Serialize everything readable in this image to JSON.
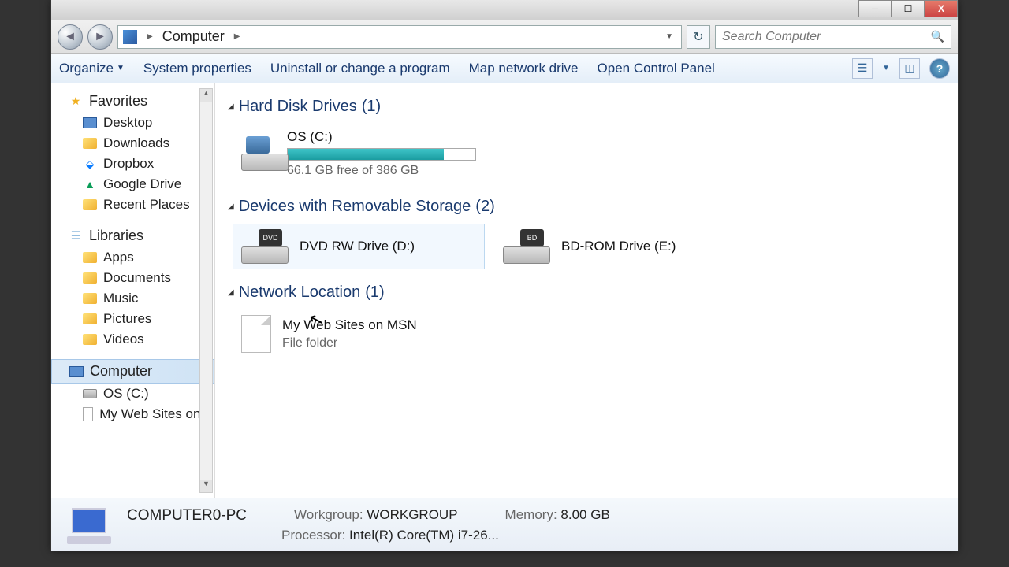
{
  "window": {
    "breadcrumb_root": "Computer",
    "search_placeholder": "Search Computer"
  },
  "toolbar": {
    "organize": "Organize",
    "system_properties": "System properties",
    "uninstall": "Uninstall or change a program",
    "map_drive": "Map network drive",
    "control_panel": "Open Control Panel"
  },
  "sidebar": {
    "favorites_label": "Favorites",
    "favorites": [
      {
        "label": "Desktop"
      },
      {
        "label": "Downloads"
      },
      {
        "label": "Dropbox"
      },
      {
        "label": "Google Drive"
      },
      {
        "label": "Recent Places"
      }
    ],
    "libraries_label": "Libraries",
    "libraries": [
      {
        "label": "Apps"
      },
      {
        "label": "Documents"
      },
      {
        "label": "Music"
      },
      {
        "label": "Pictures"
      },
      {
        "label": "Videos"
      }
    ],
    "computer_label": "Computer",
    "computer": [
      {
        "label": "OS (C:)"
      },
      {
        "label": "My Web Sites on M"
      }
    ]
  },
  "sections": {
    "hdd": {
      "title": "Hard Disk Drives",
      "count": "(1)"
    },
    "removable": {
      "title": "Devices with Removable Storage",
      "count": "(2)"
    },
    "network": {
      "title": "Network Location",
      "count": "(1)"
    }
  },
  "drives": {
    "c": {
      "name": "OS (C:)",
      "free_text": "66.1 GB free of 386 GB",
      "used_percent": 83
    },
    "d": {
      "name": "DVD RW Drive (D:)",
      "badge": "DVD"
    },
    "e": {
      "name": "BD-ROM Drive (E:)",
      "badge": "BD"
    },
    "msn": {
      "name": "My Web Sites on MSN",
      "type": "File folder"
    }
  },
  "details": {
    "computer_name": "COMPUTER0-PC",
    "workgroup_label": "Workgroup:",
    "workgroup": "WORKGROUP",
    "memory_label": "Memory:",
    "memory": "8.00 GB",
    "processor_label": "Processor:",
    "processor": "Intel(R) Core(TM) i7-26..."
  }
}
